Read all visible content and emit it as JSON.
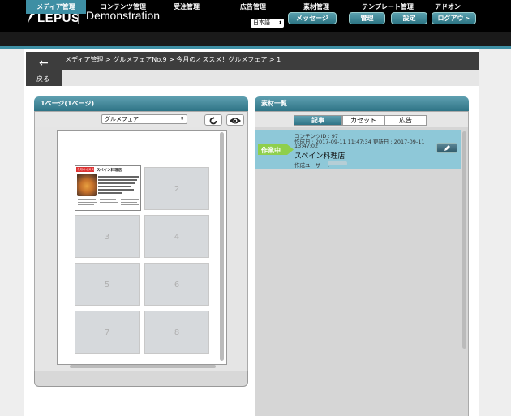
{
  "header": {
    "logo_text": "LEPUS",
    "app_title": "Demonstration",
    "language": "日本語",
    "buttons": [
      "メッセージ",
      "管理",
      "設定",
      "ログアウト"
    ]
  },
  "nav": {
    "items": [
      "メディア管理",
      "コンテンツ管理",
      "受注管理",
      "広告管理",
      "素材管理",
      "テンプレート管理",
      "アドオン"
    ],
    "active": "メディア管理"
  },
  "breadcrumb": {
    "path": "メディア管理 > グルメフェアNo.9 > 今月のオススメ！グルメフェア > 1",
    "back_label": "戻る"
  },
  "left_panel": {
    "title": "1ページ(1ページ)",
    "dropdown_value": "グルメフェア",
    "slots": [
      "2",
      "3",
      "4",
      "5",
      "6",
      "7",
      "8"
    ],
    "thumbnail": {
      "tag": "今月のオススメ",
      "title": "スペイン料理店"
    }
  },
  "right_panel": {
    "title": "素材一覧",
    "tabs": [
      "記事",
      "カセット",
      "広告"
    ],
    "active_tab": "記事",
    "items": [
      {
        "status": "作業中",
        "content_id": "コンテンツID : 97",
        "dates": "作成日 : 2017-09-11 11:47:34 更新日 : 2017-09-11",
        "time": "13:47:02",
        "title": "スペイン料理店",
        "user_label": "作成ユーザー :"
      }
    ]
  },
  "icons": {
    "refresh": "refresh-icon",
    "preview": "eye-icon",
    "edit": "pencil-icon",
    "back": "arrow-left-icon"
  },
  "colors": {
    "accent": "#3e8fa4",
    "status_badge": "#8fcf4c",
    "item_background": "#8ec8d8"
  }
}
